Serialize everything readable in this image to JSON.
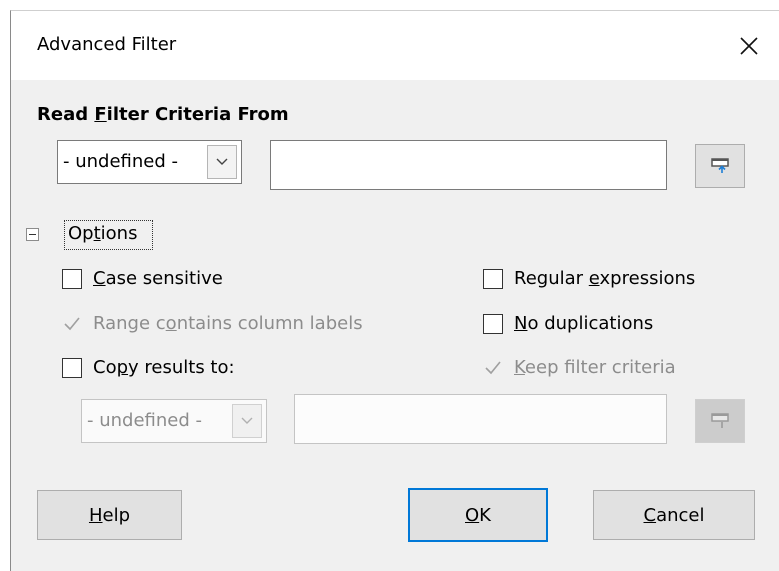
{
  "dialog": {
    "title": "Advanced Filter",
    "close_glyph": "✕",
    "accent_color": "#0078d7"
  },
  "criteria": {
    "heading_pre": "Read ",
    "heading_mn": "F",
    "heading_post": "ilter Criteria From",
    "range_select": "- undefined -",
    "range_value": "",
    "shrink_icon": "shrink-icon"
  },
  "options": {
    "label_pre": "Op",
    "label_mn": "t",
    "label_post": "ions",
    "expanded": true,
    "case_sensitive": {
      "mn": "C",
      "rest": "ase sensitive",
      "checked": false
    },
    "range_labels": {
      "pre": "Range c",
      "mn": "o",
      "post": "ntains column labels",
      "checked": true,
      "enabled": false
    },
    "copy_results": {
      "pre": "Co",
      "mn": "p",
      "post": "y results to:",
      "checked": false
    },
    "regex": {
      "pre": "Regular ",
      "mn": "e",
      "post": "xpressions",
      "checked": false
    },
    "no_dup": {
      "mn": "N",
      "rest": "o duplications",
      "checked": false
    },
    "keep_criteria": {
      "mn": "K",
      "rest": "eep filter criteria",
      "checked": true,
      "enabled": false
    },
    "copy_select": "- undefined -",
    "copy_value": ""
  },
  "buttons": {
    "help": {
      "mn": "H",
      "rest": "elp"
    },
    "ok": {
      "mn": "O",
      "rest": "K"
    },
    "cancel": {
      "mn": "C",
      "rest": "ancel"
    }
  }
}
